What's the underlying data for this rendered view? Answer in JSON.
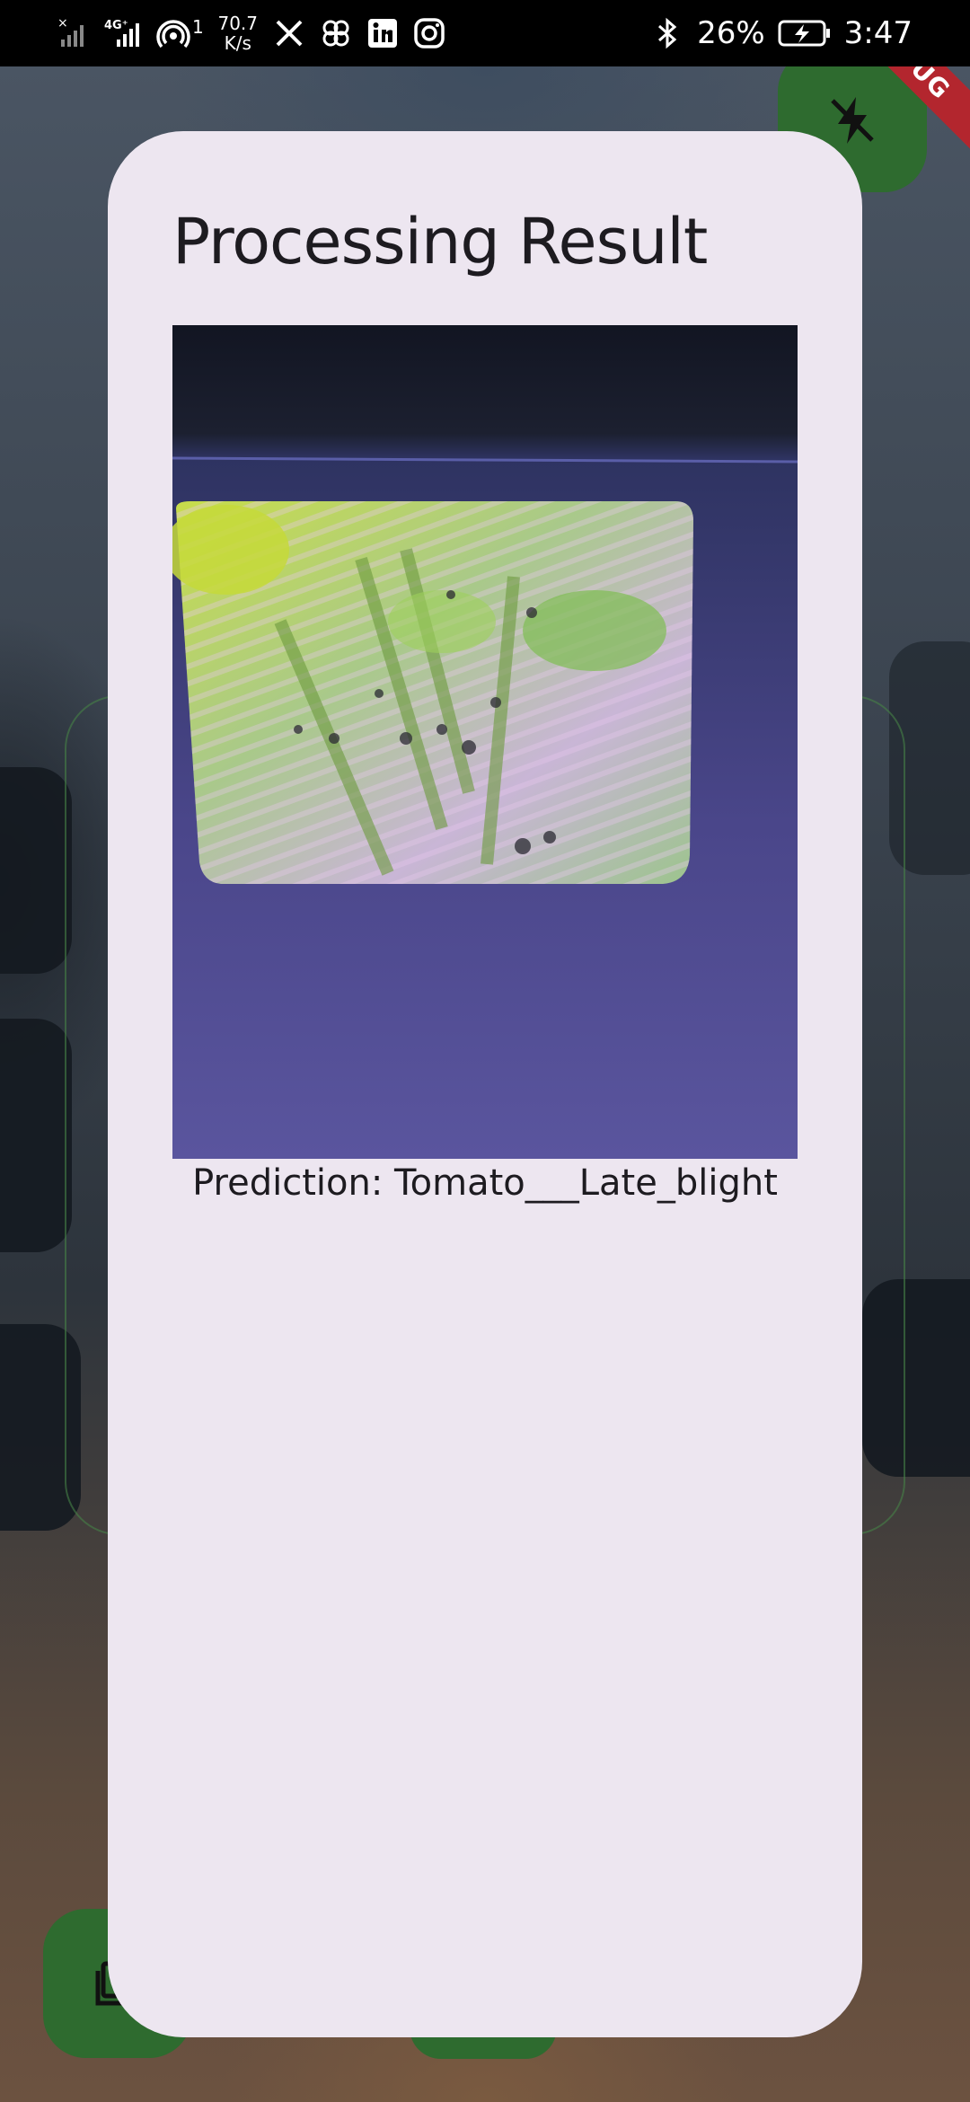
{
  "status_bar": {
    "network_type": "4G⁺",
    "hotspot_count": "1",
    "speed_value": "70.7",
    "speed_unit": "K/s",
    "battery": "26%",
    "time": "3:47"
  },
  "debug_banner": "DEBUG",
  "dialog": {
    "title": "Processing Result",
    "prediction": "Prediction: Tomato___Late_blight"
  },
  "icons": {
    "flash": "flash-off-icon",
    "gallery": "gallery-icon",
    "status": [
      "no-sim-signal-icon",
      "signal-icon",
      "hotspot-icon",
      "x-icon",
      "pinwheel-icon",
      "linkedin-icon",
      "instagram-icon",
      "bluetooth-icon",
      "battery-charging-icon"
    ]
  },
  "colors": {
    "dialog_bg": "#ede6f0",
    "fab_green": "#2e6b2f",
    "debug_red": "#b3262e",
    "title_text": "#1d1b20"
  }
}
